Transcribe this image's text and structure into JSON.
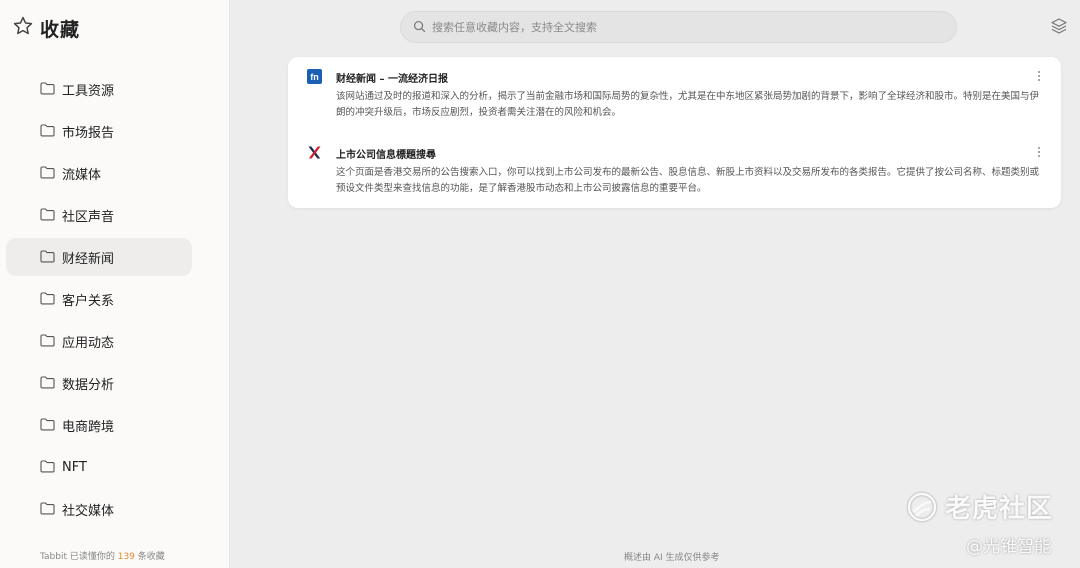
{
  "sidebar": {
    "title": "收藏",
    "items": [
      {
        "label": "工具资源"
      },
      {
        "label": "市场报告"
      },
      {
        "label": "流媒体"
      },
      {
        "label": "社区声音"
      },
      {
        "label": "财经新闻",
        "active": true
      },
      {
        "label": "客户关系"
      },
      {
        "label": "应用动态"
      },
      {
        "label": "数据分析"
      },
      {
        "label": "电商跨境"
      },
      {
        "label": "NFT"
      },
      {
        "label": "社交媒体"
      }
    ],
    "footer": {
      "prefix": "Tabbit 已读懂你的",
      "count": "139",
      "suffix": "条收藏"
    }
  },
  "search": {
    "placeholder": "搜索任意收藏内容，支持全文搜索"
  },
  "entries": [
    {
      "icon": "fn-logo-icon",
      "title": "财经新闻 – 一流经济日报",
      "description": "该网站通过及时的报道和深入的分析，揭示了当前金融市场和国际局势的复杂性，尤其是在中东地区紧张局势加剧的背景下，影响了全球经济和股市。特别是在美国与伊朗的冲突升级后，市场反应剧烈，投资者需关注潜在的风险和机会。"
    },
    {
      "icon": "hkex-logo-icon",
      "title": "上市公司信息標題搜尋",
      "description": "这个页面是香港交易所的公告搜索入口，你可以找到上市公司发布的最新公告、股息信息、新股上市资料以及交易所发布的各类报告。它提供了按公司名称、标题类别或预设文件类型来查找信息的功能，是了解香港股市动态和上市公司披露信息的重要平台。"
    }
  ],
  "footer_note": "概述由 AI 生成仅供参考",
  "watermark": {
    "brand": "老虎社区",
    "sub": "@光锥智能"
  },
  "colors": {
    "accent_count": "#e08a2e",
    "fn_logo": "#1a5fb4",
    "hkex_red": "#d0202e",
    "hkex_navy": "#1b2a4e"
  }
}
